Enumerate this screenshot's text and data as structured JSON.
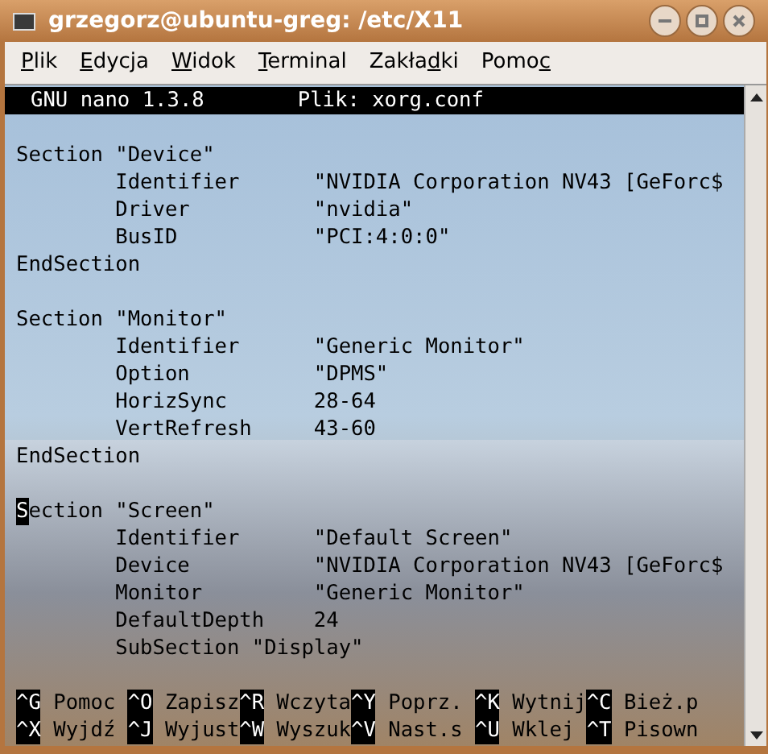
{
  "window": {
    "title": "grzegorz@ubuntu-greg: /etc/X11"
  },
  "menu": [
    {
      "key": "P",
      "after": "lik"
    },
    {
      "key": "E",
      "after": "dycja"
    },
    {
      "key": "W",
      "after": "idok"
    },
    {
      "key": "T",
      "after": "erminal"
    },
    {
      "before": "Zakła",
      "key": "d",
      "after": "ki"
    },
    {
      "before": "Pomo",
      "key": "c"
    }
  ],
  "nano_header": {
    "version": "GNU nano 1.3.8",
    "file": "Plik: xorg.conf"
  },
  "lines": [
    {
      "kind": "blank"
    },
    {
      "kind": "code",
      "text": "Section \"Device\""
    },
    {
      "kind": "code",
      "text": "        Identifier      \"NVIDIA Corporation NV43 [GeForc$"
    },
    {
      "kind": "code",
      "text": "        Driver          \"nvidia\""
    },
    {
      "kind": "code",
      "text": "        BusID           \"PCI:4:0:0\""
    },
    {
      "kind": "code",
      "text": "EndSection"
    },
    {
      "kind": "blank"
    },
    {
      "kind": "code",
      "text": "Section \"Monitor\""
    },
    {
      "kind": "code",
      "text": "        Identifier      \"Generic Monitor\""
    },
    {
      "kind": "code",
      "text": "        Option          \"DPMS\""
    },
    {
      "kind": "code",
      "text": "        HorizSync       28-64"
    },
    {
      "kind": "code",
      "text": "        VertRefresh     43-60"
    },
    {
      "kind": "code",
      "text": "EndSection"
    },
    {
      "kind": "blank"
    },
    {
      "kind": "code",
      "cursor": "S",
      "text": "ection \"Screen\""
    },
    {
      "kind": "code",
      "text": "        Identifier      \"Default Screen\""
    },
    {
      "kind": "code",
      "text": "        Device          \"NVIDIA Corporation NV43 [GeForc$"
    },
    {
      "kind": "code",
      "text": "        Monitor         \"Generic Monitor\""
    },
    {
      "kind": "code",
      "text": "        DefaultDepth    24"
    },
    {
      "kind": "code",
      "text": "        SubSection \"Display\""
    },
    {
      "kind": "blank"
    }
  ],
  "shortcuts": [
    [
      {
        "key": "^G",
        "label": "Pomoc"
      },
      {
        "key": "^O",
        "label": "Zapisz"
      },
      {
        "key": "^R",
        "label": "Wczyta"
      },
      {
        "key": "^Y",
        "label": "Poprz."
      },
      {
        "key": "^K",
        "label": "Wytnij"
      },
      {
        "key": "^C",
        "label": "Bież.p"
      }
    ],
    [
      {
        "key": "^X",
        "label": "Wyjdź"
      },
      {
        "key": "^J",
        "label": "Wyjust"
      },
      {
        "key": "^W",
        "label": "Wyszuk"
      },
      {
        "key": "^V",
        "label": "Nast.s"
      },
      {
        "key": "^U",
        "label": "Wklej"
      },
      {
        "key": "^T",
        "label": "Pisown"
      }
    ]
  ]
}
